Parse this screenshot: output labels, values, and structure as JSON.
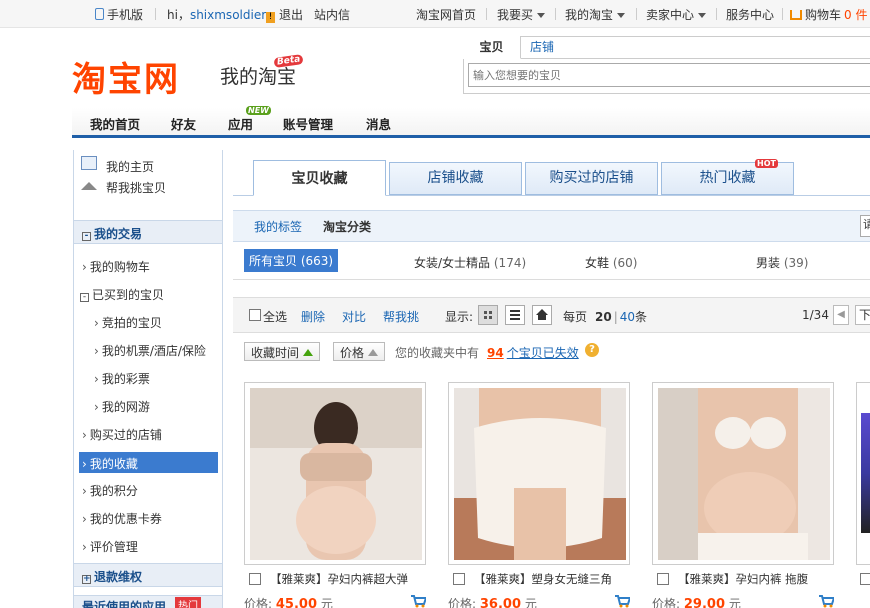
{
  "topbar": {
    "mobile": "手机版",
    "greeting": "hi，",
    "username": "shixmsoldier",
    "logout": "退出",
    "inbox": "站内信",
    "home": "淘宝网首页",
    "buy": "我要买",
    "mytaobao": "我的淘宝",
    "seller": "卖家中心",
    "service": "服务中心",
    "cart": "购物车",
    "cart_count": "0 件"
  },
  "header": {
    "logo": "淘宝网",
    "title": "我的淘宝",
    "beta": "Beta",
    "search_tab_active": "宝贝",
    "search_tab_other": "店铺",
    "search_placeholder": "输入您想要的宝贝"
  },
  "nav": {
    "items": [
      "我的首页",
      "好友",
      "应用",
      "账号管理",
      "消息"
    ],
    "new_badge": "NEW"
  },
  "sidebar": {
    "top_links": [
      "我的主页",
      "帮我挑宝贝"
    ],
    "section_trade": "我的交易",
    "items": [
      "我的购物车",
      "已买到的宝贝",
      "竞拍的宝贝",
      "我的机票/酒店/保险",
      "我的彩票",
      "我的网游",
      "购买过的店铺",
      "我的收藏",
      "我的积分",
      "我的优惠卡券",
      "评价管理"
    ],
    "section_refund": "退款维权",
    "section_apps": "最近使用的应用",
    "hot_badge": "热门"
  },
  "tabs": {
    "items": [
      "宝贝收藏",
      "店铺收藏",
      "购买过的店铺",
      "热门收藏"
    ],
    "hot_badge": "HOT"
  },
  "subtabs": {
    "items": [
      "我的标签",
      "淘宝分类"
    ],
    "search_stub": "请"
  },
  "categories": [
    {
      "label": "所有宝贝",
      "count": "(663)"
    },
    {
      "label": "女装/女士精品",
      "count": "(174)"
    },
    {
      "label": "女鞋",
      "count": "(60)"
    },
    {
      "label": "男装",
      "count": "(39)"
    }
  ],
  "toolbar": {
    "select_all": "全选",
    "delete": "删除",
    "compare": "对比",
    "help_pick": "帮我挑",
    "display": "显示:",
    "per_page_label": "每页",
    "per_page_20": "20",
    "per_page_sep": "|",
    "per_page_40": "40",
    "per_page_unit": "条",
    "page": "1/34",
    "next": "下"
  },
  "sort": {
    "by_time": "收藏时间",
    "by_price": "价格",
    "notice_pre": "您的收藏夹中有",
    "invalid_count": "94",
    "notice_post": "个宝贝已失效"
  },
  "products": [
    {
      "name": "【雅莱爽】孕妇内裤超大弹",
      "price_label": "价格:",
      "price": "45.00",
      "unit": "元"
    },
    {
      "name": "【雅莱爽】塑身女无缝三角",
      "price_label": "价格:",
      "price": "36.00",
      "unit": "元"
    },
    {
      "name": "【雅莱爽】孕妇内裤 拖腹",
      "price_label": "价格:",
      "price": "29.00",
      "unit": "元"
    }
  ],
  "colors": {
    "brand_orange": "#ff4400",
    "nav_blue": "#1f5fa8",
    "active_blue": "#3b7bcf",
    "price_red": "#ff4400"
  }
}
